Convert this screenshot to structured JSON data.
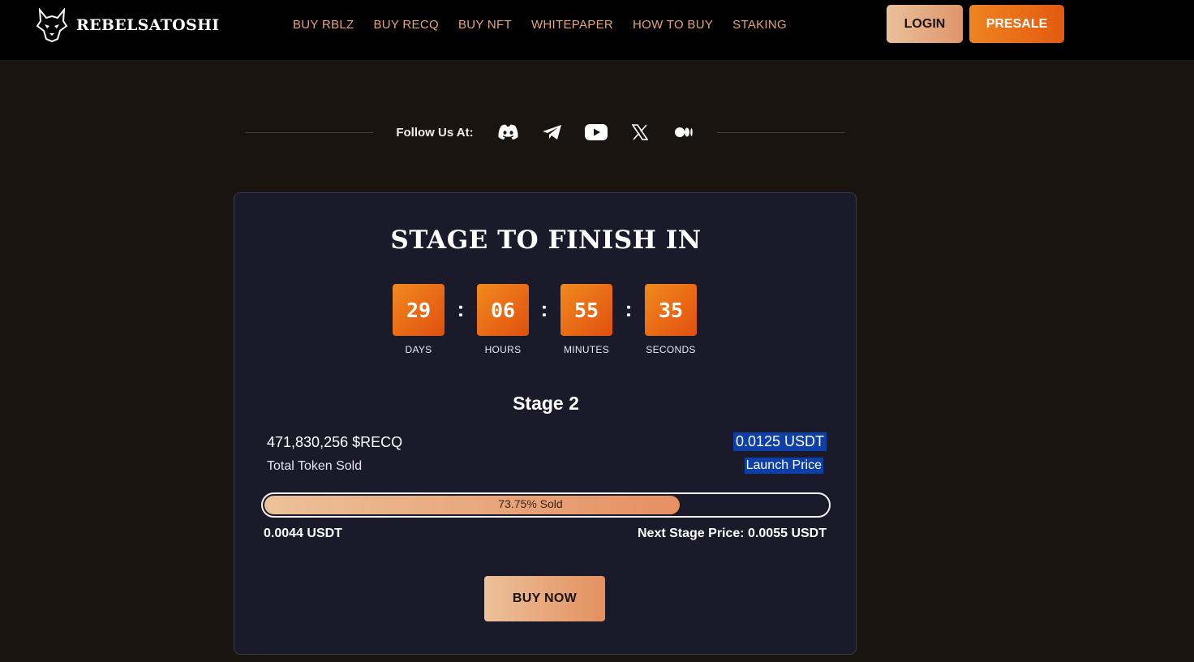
{
  "header": {
    "brand": "REBELSATOSHI",
    "nav": [
      "BUY RBLZ",
      "BUY RECQ",
      "BUY NFT",
      "WHITEPAPER",
      "HOW TO BUY",
      "STAKING"
    ],
    "login_label": "LOGIN",
    "presale_label": "PRESALE"
  },
  "follow": {
    "label": "Follow Us At:",
    "icons": [
      "discord-icon",
      "telegram-icon",
      "youtube-icon",
      "x-icon",
      "medium-icon"
    ]
  },
  "presale": {
    "title": "STAGE TO FINISH IN",
    "countdown": [
      {
        "value": "29",
        "label": "DAYS"
      },
      {
        "value": "06",
        "label": "HOURS"
      },
      {
        "value": "55",
        "label": "MINUTES"
      },
      {
        "value": "35",
        "label": "SECONDS"
      }
    ],
    "stage": "Stage 2",
    "tokens_sold": "471,830,256 $RECQ",
    "tokens_sold_label": "Total Token Sold",
    "launch_price": "0.0125 USDT",
    "launch_price_label": "Launch Price",
    "progress_percent": 73.75,
    "progress_text": "73.75% Sold",
    "current_price": "0.0044 USDT",
    "next_stage_price": "Next Stage Price: 0.0055 USDT",
    "buy_label": "BUY NOW"
  },
  "colors": {
    "accent_orange": "#f0831f",
    "accent_peach": "#e8c09a",
    "nav_text": "#e8a57c",
    "card_bg": "#1b1a2b",
    "page_bg": "#1a1410"
  }
}
